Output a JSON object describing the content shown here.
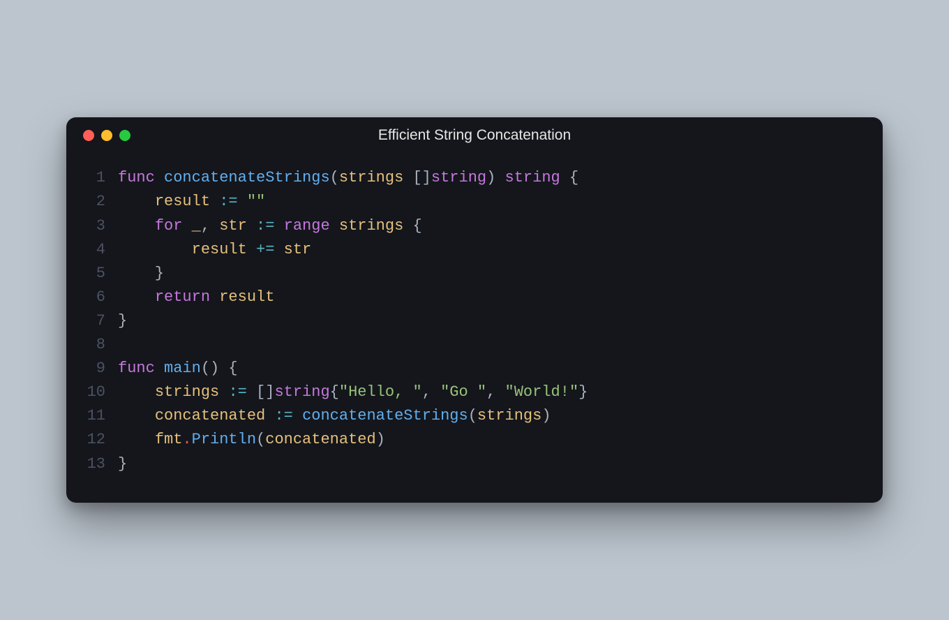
{
  "window": {
    "title": "Efficient String Concatenation"
  },
  "code": {
    "lines": [
      {
        "n": "1",
        "tokens": [
          [
            "kw",
            "func"
          ],
          [
            "pn",
            " "
          ],
          [
            "fn",
            "concatenateStrings"
          ],
          [
            "pn",
            "("
          ],
          [
            "id",
            "strings"
          ],
          [
            "pn",
            " []"
          ],
          [
            "type",
            "string"
          ],
          [
            "pn",
            ") "
          ],
          [
            "type",
            "string"
          ],
          [
            "pn",
            " {"
          ]
        ]
      },
      {
        "n": "2",
        "tokens": [
          [
            "pn",
            "    "
          ],
          [
            "id",
            "result"
          ],
          [
            "pn",
            " "
          ],
          [
            "op",
            ":="
          ],
          [
            "pn",
            " "
          ],
          [
            "str",
            "\"\""
          ]
        ]
      },
      {
        "n": "3",
        "tokens": [
          [
            "pn",
            "    "
          ],
          [
            "kw",
            "for"
          ],
          [
            "pn",
            " "
          ],
          [
            "id",
            "_"
          ],
          [
            "pn",
            ", "
          ],
          [
            "id",
            "str"
          ],
          [
            "pn",
            " "
          ],
          [
            "op",
            ":="
          ],
          [
            "pn",
            " "
          ],
          [
            "kw",
            "range"
          ],
          [
            "pn",
            " "
          ],
          [
            "id",
            "strings"
          ],
          [
            "pn",
            " {"
          ]
        ]
      },
      {
        "n": "4",
        "tokens": [
          [
            "pn",
            "        "
          ],
          [
            "id",
            "result"
          ],
          [
            "pn",
            " "
          ],
          [
            "op",
            "+="
          ],
          [
            "pn",
            " "
          ],
          [
            "id",
            "str"
          ]
        ]
      },
      {
        "n": "5",
        "tokens": [
          [
            "pn",
            "    }"
          ]
        ]
      },
      {
        "n": "6",
        "tokens": [
          [
            "pn",
            "    "
          ],
          [
            "kw",
            "return"
          ],
          [
            "pn",
            " "
          ],
          [
            "id",
            "result"
          ]
        ]
      },
      {
        "n": "7",
        "tokens": [
          [
            "pn",
            "}"
          ]
        ]
      },
      {
        "n": "8",
        "tokens": []
      },
      {
        "n": "9",
        "tokens": [
          [
            "kw",
            "func"
          ],
          [
            "pn",
            " "
          ],
          [
            "fn",
            "main"
          ],
          [
            "pn",
            "() {"
          ]
        ]
      },
      {
        "n": "10",
        "tokens": [
          [
            "pn",
            "    "
          ],
          [
            "id",
            "strings"
          ],
          [
            "pn",
            " "
          ],
          [
            "op",
            ":="
          ],
          [
            "pn",
            " []"
          ],
          [
            "type",
            "string"
          ],
          [
            "pn",
            "{"
          ],
          [
            "str",
            "\"Hello, \""
          ],
          [
            "pn",
            ", "
          ],
          [
            "str",
            "\"Go \""
          ],
          [
            "pn",
            ", "
          ],
          [
            "str",
            "\"World!\""
          ],
          [
            "pn",
            "}"
          ]
        ]
      },
      {
        "n": "11",
        "tokens": [
          [
            "pn",
            "    "
          ],
          [
            "id",
            "concatenated"
          ],
          [
            "pn",
            " "
          ],
          [
            "op",
            ":="
          ],
          [
            "pn",
            " "
          ],
          [
            "fn",
            "concatenateStrings"
          ],
          [
            "pn",
            "("
          ],
          [
            "id",
            "strings"
          ],
          [
            "pn",
            ")"
          ]
        ]
      },
      {
        "n": "12",
        "tokens": [
          [
            "pn",
            "    "
          ],
          [
            "id",
            "fmt"
          ],
          [
            "dot",
            "."
          ],
          [
            "fn",
            "Println"
          ],
          [
            "pn",
            "("
          ],
          [
            "id",
            "concatenated"
          ],
          [
            "pn",
            ")"
          ]
        ]
      },
      {
        "n": "13",
        "tokens": [
          [
            "pn",
            "}"
          ]
        ]
      }
    ]
  }
}
